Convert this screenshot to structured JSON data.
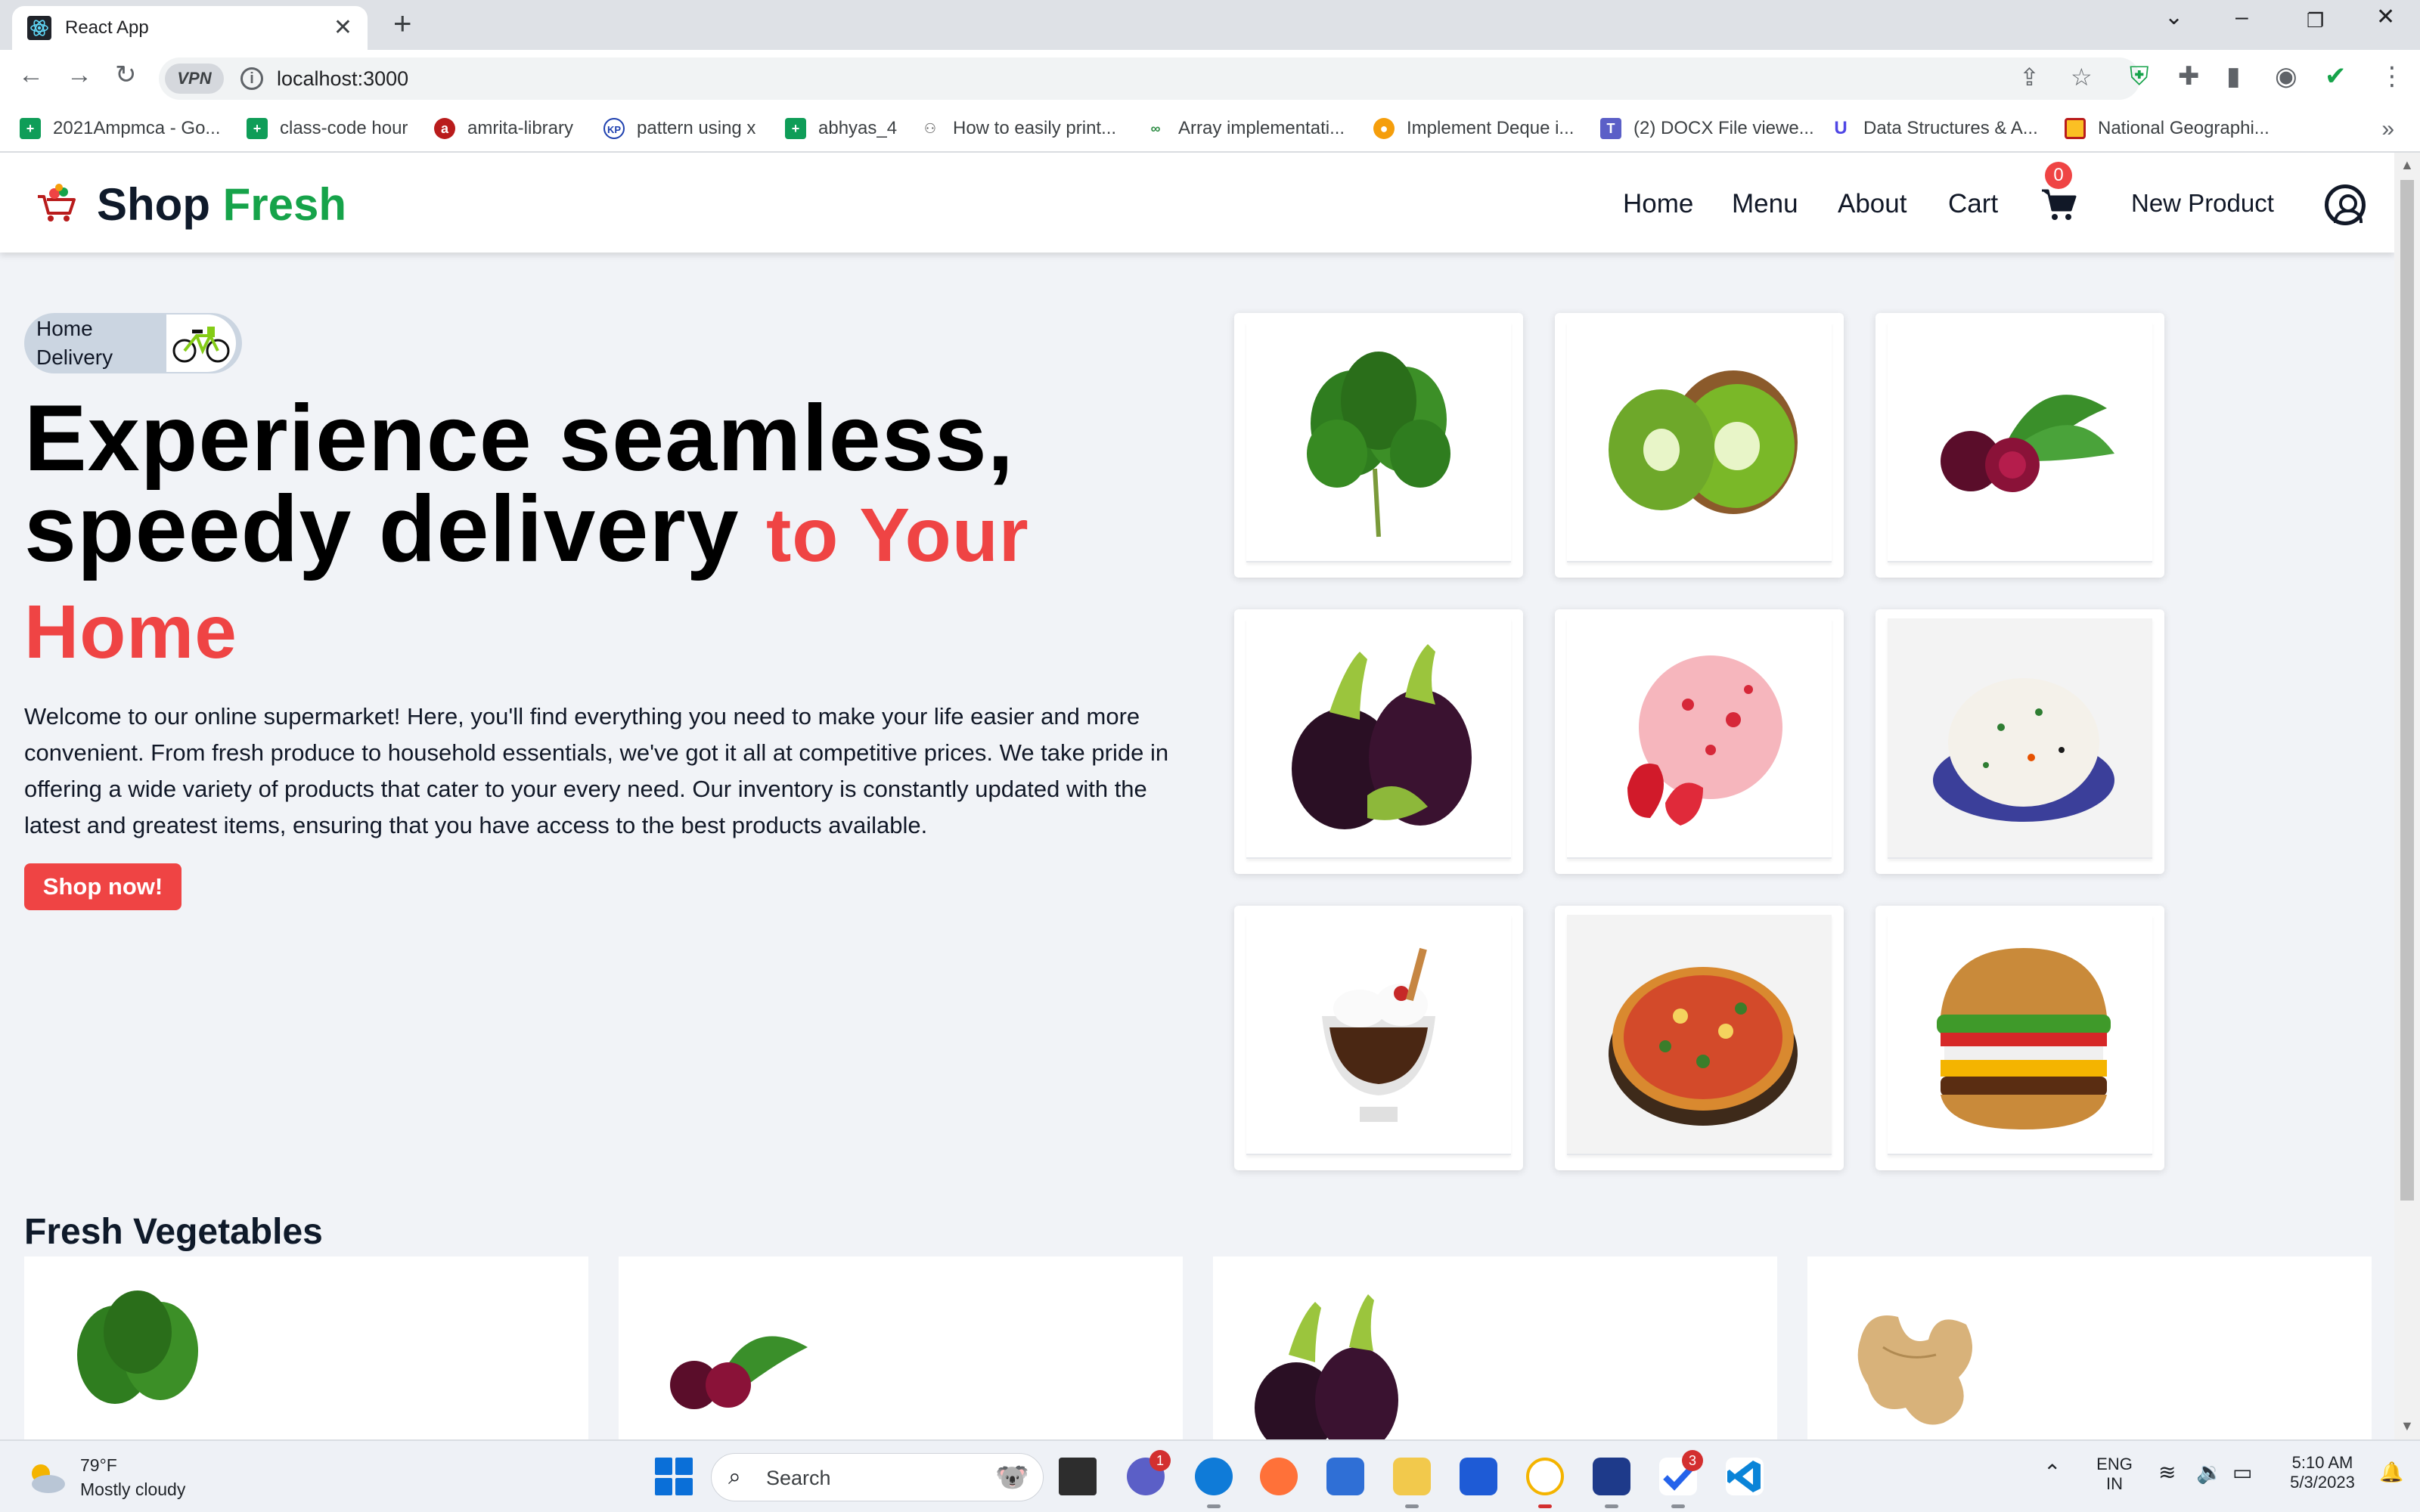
{
  "browser": {
    "tab_title": "React App",
    "tab_close": "✕",
    "new_tab": "+",
    "url": "localhost:3000",
    "vpn_label": "VPN",
    "bookmarks": [
      "2021Ampmca - Go...",
      "class-code hour",
      "amrita-library",
      "pattern using x",
      "abhyas_4",
      "How to easily print...",
      "Array implementati...",
      "Implement Deque i...",
      "(2) DOCX File viewe...",
      "Data Structures & A...",
      "National Geographi..."
    ]
  },
  "header": {
    "brand_main": "Shop ",
    "brand_accent": "Fresh",
    "nav": [
      "Home",
      "Menu",
      "About",
      "Cart"
    ],
    "cart_count": "0",
    "new_product": "New Product"
  },
  "hero": {
    "badge_text": "Home Delivery",
    "title_line1": "Experience seamless,",
    "title_line2": "speedy delivery ",
    "title_red_1": "to Your",
    "title_red_2": "Home",
    "description": "Welcome to our online supermarket! Here, you'll find everything you need to make your life easier and more convenient. From fresh produce to household essentials, we've got it all at competitive prices. We take pride in offering a wide variety of products that cater to your every need. Our inventory is constantly updated with the latest and greatest items, ensuring that you have access to the best products available.",
    "cta": "Shop now!"
  },
  "gallery": [
    "spinach-image",
    "kiwi-image",
    "beetroot-image",
    "eggplant-image",
    "strawberry-icecream-image",
    "rice-plate-image",
    "dessert-cup-image",
    "pizza-image",
    "burger-image"
  ],
  "section": {
    "title": "Fresh Vegetables"
  },
  "taskbar": {
    "temperature": "79°F",
    "weather": "Mostly cloudy",
    "search": "Search",
    "lang1": "ENG",
    "lang2": "IN",
    "time": "5:10 AM",
    "date": "5/3/2023",
    "teams_badge": "1",
    "todo_badge": "3"
  },
  "colors": {
    "accent_green": "#16a34a",
    "accent_red": "#ef4444",
    "page_bg": "#f1f3f7"
  }
}
